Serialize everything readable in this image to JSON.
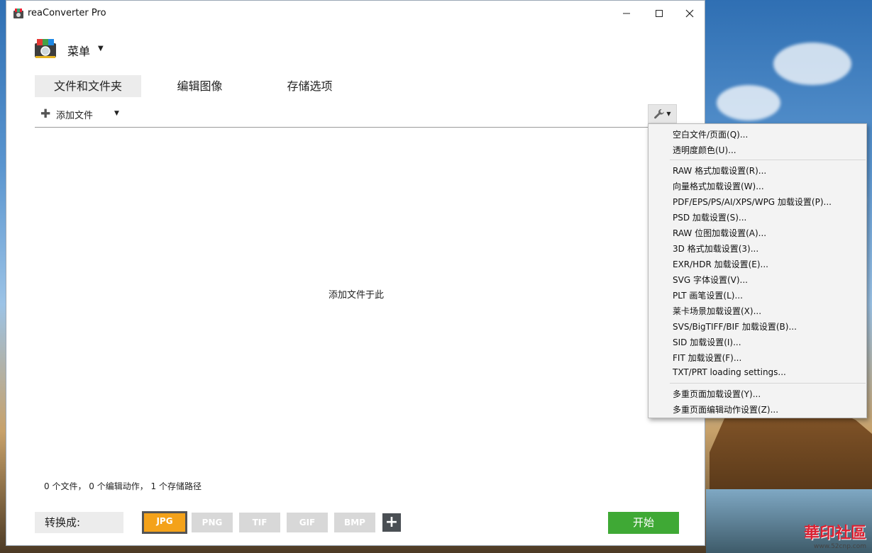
{
  "window": {
    "title": "reaConverter Pro",
    "controls": {
      "minimize": "—",
      "maximize": "☐",
      "close": "✕"
    }
  },
  "menu": {
    "label": "菜单",
    "logo_icon": "rea-camera-logo-icon"
  },
  "tabs": [
    {
      "label": "文件和文件夹",
      "active": true
    },
    {
      "label": "编辑图像",
      "active": false
    },
    {
      "label": "存储选项",
      "active": false
    }
  ],
  "toolbar": {
    "add_label": "添加文件",
    "add_icon": "plus-icon",
    "settings_icon": "wrench-icon"
  },
  "main": {
    "drop_hint": "添加文件于此"
  },
  "status": {
    "summary": "0 个文件，  0 个编辑动作，  1 个存储路径"
  },
  "bottom": {
    "convert_label": "转换成:",
    "formats": [
      {
        "label": "JPG",
        "selected": true
      },
      {
        "label": "PNG",
        "selected": false
      },
      {
        "label": "TIF",
        "selected": false
      },
      {
        "label": "GIF",
        "selected": false
      },
      {
        "label": "BMP",
        "selected": false
      }
    ],
    "add_format_label": "+",
    "start_label": "开始"
  },
  "context_menu": {
    "items": [
      "空白文件/页面(Q)...",
      "透明度颜色(U)...",
      "RAW 格式加载设置(R)...",
      "向量格式加载设置(W)...",
      "PDF/EPS/PS/AI/XPS/WPG 加载设置(P)...",
      "PSD 加载设置(S)...",
      "RAW 位图加载设置(A)...",
      "3D 格式加载设置(3)...",
      "EXR/HDR 加载设置(E)...",
      "SVG 字体设置(V)...",
      "PLT 画笔设置(L)...",
      "莱卡场景加载设置(X)...",
      "SVS/BigTIFF/BIF 加载设置(B)...",
      "SID 加载设置(I)...",
      "FIT 加载设置(F)...",
      "TXT/PRT loading settings...",
      "多重页面加载设置(Y)...",
      "多重页面编辑动作设置(Z)..."
    ]
  },
  "desktop": {
    "watermark": "華印社區",
    "watermark_url": "www.52cnp.com"
  },
  "colors": {
    "accent_selected": "#f4a21a",
    "start_green": "#3fa935"
  }
}
